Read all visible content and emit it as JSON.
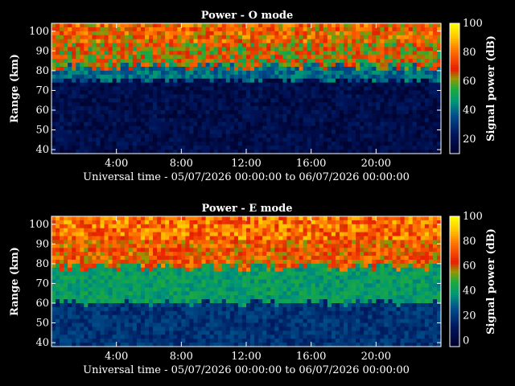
{
  "chart_data": [
    {
      "type": "heatmap",
      "title": "Power - O mode",
      "xlabel": "Universal time - 05/07/2026 00:00:00 to 06/07/2026 00:00:00",
      "ylabel": "Range (km)",
      "colorbar_label": "Signal power (dB)",
      "x_ticks": [
        "4:00",
        "8:00",
        "12:00",
        "16:00",
        "20:00"
      ],
      "x_tick_hours": [
        4,
        8,
        12,
        16,
        20
      ],
      "xlim_hours": [
        0,
        24
      ],
      "y_ticks": [
        40,
        50,
        60,
        70,
        80,
        90,
        100
      ],
      "ylim": [
        38,
        104
      ],
      "colorbar_ticks": [
        20,
        40,
        60,
        80,
        100
      ],
      "clim": [
        10,
        100
      ],
      "profile": {
        "base_top_km": 75,
        "echo_bottom_km": 82,
        "peak_km": 93,
        "noise_level_db": 12,
        "echo_level_db": 65
      }
    },
    {
      "type": "heatmap",
      "title": "Power - E mode",
      "xlabel": "Universal time - 05/07/2026 00:00:00 to 06/07/2026 00:00:00",
      "ylabel": "Range (km)",
      "colorbar_label": "Signal power (dB)",
      "x_ticks": [
        "4:00",
        "8:00",
        "12:00",
        "16:00",
        "20:00"
      ],
      "x_tick_hours": [
        4,
        8,
        12,
        16,
        20
      ],
      "xlim_hours": [
        0,
        24
      ],
      "y_ticks": [
        40,
        50,
        60,
        70,
        80,
        90,
        100
      ],
      "ylim": [
        38,
        104
      ],
      "colorbar_ticks": [
        0,
        20,
        40,
        60,
        80,
        100
      ],
      "clim": [
        -5,
        100
      ],
      "profile": {
        "base_top_km": 60,
        "echo_bottom_km": 78,
        "peak_km": 92,
        "noise_level_db": 12,
        "echo_level_db": 68
      }
    }
  ]
}
